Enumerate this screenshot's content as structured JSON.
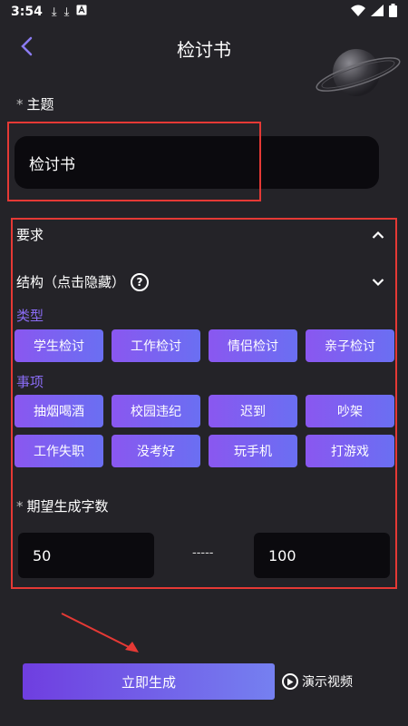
{
  "status_bar": {
    "time": "3:54",
    "icons": [
      "download-icon",
      "download-icon",
      "font-icon"
    ],
    "right_icons": [
      "wifi-icon",
      "signal-icon",
      "battery-icon"
    ]
  },
  "header": {
    "title": "检讨书",
    "back_icon": "chevron-left-icon"
  },
  "subject": {
    "required_mark": "*",
    "label": "主题",
    "value": "检讨书"
  },
  "requirements": {
    "title": "要求",
    "structure_label": "结构（点击隐藏）",
    "help_icon": "?",
    "type_label": "类型",
    "types": [
      "学生检讨",
      "工作检讨",
      "情侣检讨",
      "亲子检讨"
    ],
    "matters_label": "事项",
    "matters": [
      "抽烟喝酒",
      "校园违纪",
      "迟到",
      "吵架",
      "工作失职",
      "没考好",
      "玩手机",
      "打游戏"
    ],
    "word_count": {
      "required_mark": "*",
      "label": "期望生成字数",
      "min": "50",
      "separator": "-----",
      "max": "100"
    }
  },
  "footer": {
    "generate_label": "立即生成",
    "demo_label": "演示视频"
  },
  "colors": {
    "background": "#242328",
    "input_bg": "#0b0a0e",
    "accent_purple": "#8a6cf5",
    "annotation_red": "#e53935"
  }
}
